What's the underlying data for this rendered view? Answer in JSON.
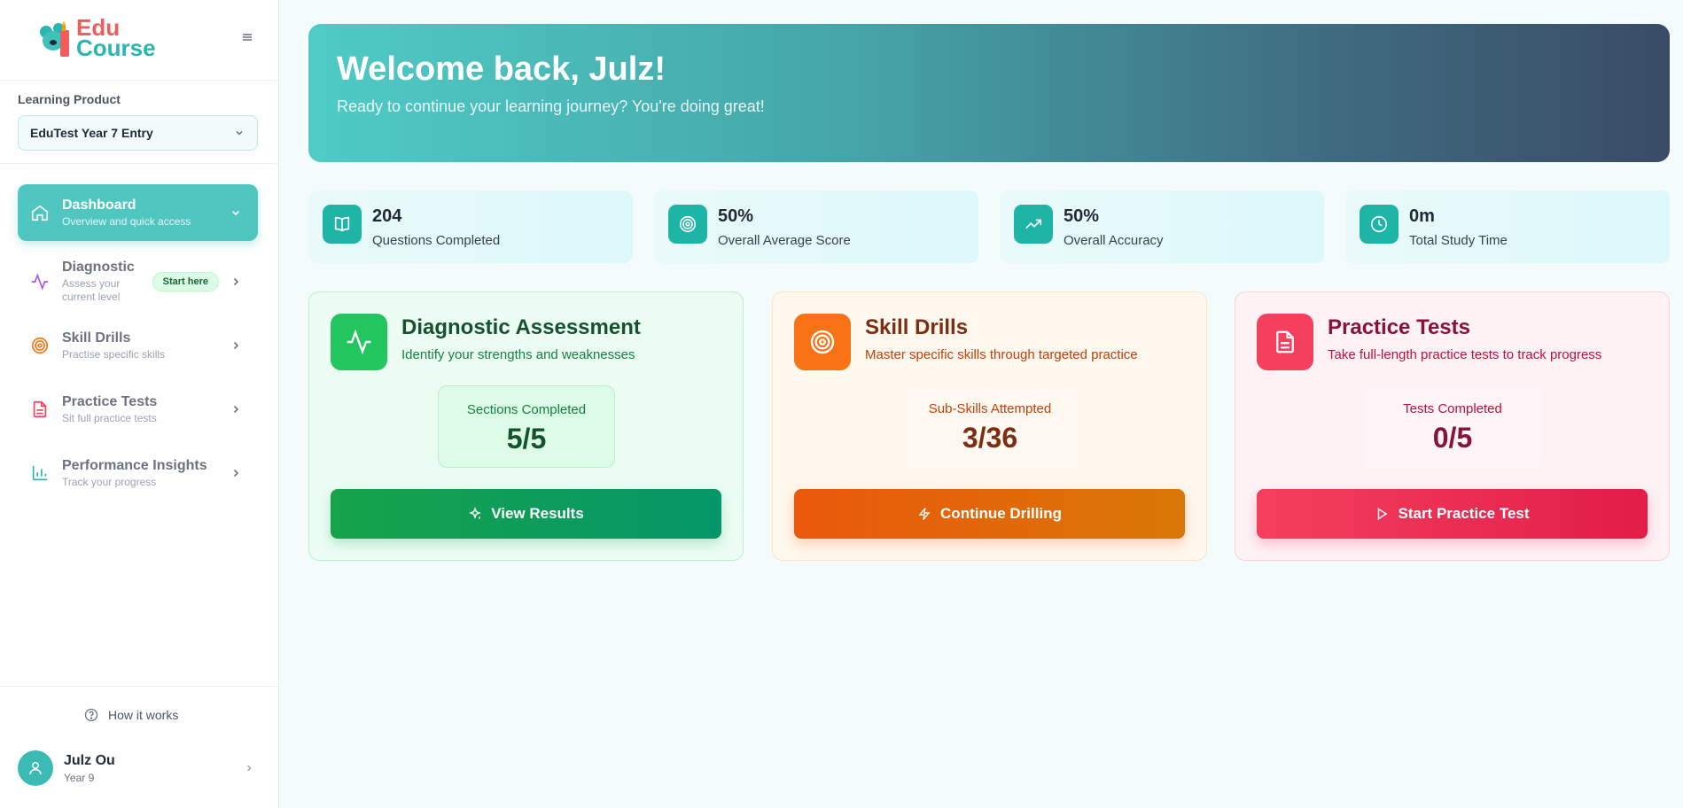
{
  "brand": {
    "line1": "Edu",
    "line2": "Course",
    "icon": "koala-logo"
  },
  "sidebar": {
    "product_label": "Learning Product",
    "product_value": "EduTest Year 7 Entry",
    "items": [
      {
        "title": "Dashboard",
        "subtitle": "Overview and quick access",
        "icon": "home-icon",
        "active": true
      },
      {
        "title": "Diagnostic",
        "subtitle": "Assess your current level",
        "icon": "activity-icon",
        "badge": "Start here",
        "accent": "#a855f7"
      },
      {
        "title": "Skill Drills",
        "subtitle": "Practise specific skills",
        "icon": "target-icon",
        "accent": "#f97316"
      },
      {
        "title": "Practice Tests",
        "subtitle": "Sit full practice tests",
        "icon": "file-text-icon",
        "accent": "#f43f5e"
      },
      {
        "title": "Performance Insights",
        "subtitle": "Track your progress",
        "icon": "bar-chart-icon",
        "accent": "#2bb5b0"
      }
    ],
    "how_it_works": "How it works",
    "user": {
      "name": "Julz Ou",
      "role": "Year 9"
    }
  },
  "hero": {
    "title": "Welcome back, Julz!",
    "subtitle": "Ready to continue your learning journey? You're doing great!"
  },
  "stats": [
    {
      "value": "204",
      "label": "Questions Completed",
      "icon": "book-icon"
    },
    {
      "value": "50%",
      "label": "Overall Average Score",
      "icon": "target-icon"
    },
    {
      "value": "50%",
      "label": "Overall Accuracy",
      "icon": "trending-up-icon"
    },
    {
      "value": "0m",
      "label": "Total Study Time",
      "icon": "clock-icon"
    }
  ],
  "cards": [
    {
      "title": "Diagnostic Assessment",
      "subtitle": "Identify your strengths and weaknesses",
      "stat_label": "Sections Completed",
      "stat_value": "5/5",
      "button": "View Results",
      "button_icon": "sparkles-icon",
      "color": "#22c55e"
    },
    {
      "title": "Skill Drills",
      "subtitle": "Master specific skills through targeted practice",
      "stat_label": "Sub-Skills Attempted",
      "stat_value": "3/36",
      "button": "Continue Drilling",
      "button_icon": "zap-icon",
      "color": "#f97316"
    },
    {
      "title": "Practice Tests",
      "subtitle": "Take full-length practice tests to track progress",
      "stat_label": "Tests Completed",
      "stat_value": "0/5",
      "button": "Start Practice Test",
      "button_icon": "play-icon",
      "color": "#f43f5e"
    }
  ]
}
